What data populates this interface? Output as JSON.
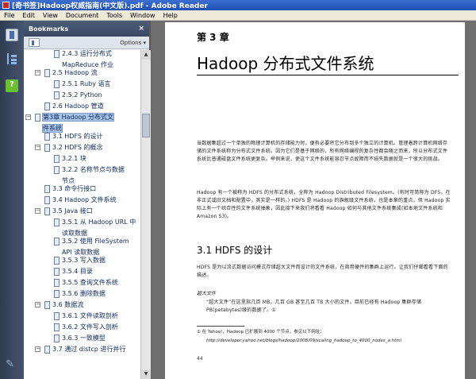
{
  "window": {
    "title": "[奇书签]Hadoop权威指南(中文版).pdf - Adobe Reader"
  },
  "menu": [
    "File",
    "Edit",
    "View",
    "Document",
    "Tools",
    "Window",
    "Help"
  ],
  "panel": {
    "title": "Bookmarks",
    "close": "×",
    "options": "Options ▾"
  },
  "bookmarks": [
    {
      "label": "2.4.3 运行分布式",
      "level": 2,
      "expand": ""
    },
    {
      "label": "MapReduce 作业",
      "level": 2,
      "cont": true
    },
    {
      "label": "2.5 Hadoop 流",
      "level": 1,
      "expand": "−"
    },
    {
      "label": "2.5.1 Ruby 语言",
      "level": 2
    },
    {
      "label": "2.5.2 Python",
      "level": 2
    },
    {
      "label": "2.6 Hadoop 管道",
      "level": 1
    },
    {
      "label": "第3章  Hadoop 分布式文",
      "level": 0,
      "expand": "−",
      "selected": true
    },
    {
      "label": "件系统",
      "level": 0,
      "cont": true,
      "selected": true
    },
    {
      "label": "3.1 HDFS 的设计",
      "level": 1
    },
    {
      "label": "3.2 HDFS 的概念",
      "level": 1,
      "expand": "−"
    },
    {
      "label": "3.2.1 块",
      "level": 2
    },
    {
      "label": "3.2.2 名称节点与数据",
      "level": 2
    },
    {
      "label": "节点",
      "level": 2,
      "cont": true
    },
    {
      "label": "3.3 命令行接口",
      "level": 1
    },
    {
      "label": "3.4 Hadoop 文件系统",
      "level": 1
    },
    {
      "label": "3.5 Java 接口",
      "level": 1,
      "expand": "−"
    },
    {
      "label": "3.5.1 从 Hadoop URL 中",
      "level": 2
    },
    {
      "label": "读取数据",
      "level": 2,
      "cont": true
    },
    {
      "label": "3.5.2 使用 FileSystem",
      "level": 2
    },
    {
      "label": "API 读取数据",
      "level": 2,
      "cont": true
    },
    {
      "label": "3.5.3 写入数据",
      "level": 2
    },
    {
      "label": "3.5.4 目录",
      "level": 2
    },
    {
      "label": "3.5.5 查询文件系统",
      "level": 2
    },
    {
      "label": "3.5.6 删除数据",
      "level": 2
    },
    {
      "label": "3.6 数据流",
      "level": 1,
      "expand": "−"
    },
    {
      "label": "3.6.1 文件读取剖析",
      "level": 2
    },
    {
      "label": "3.6.2 文件写入剖析",
      "level": 2
    },
    {
      "label": "3.6.3 一致模型",
      "level": 2
    },
    {
      "label": "3.7 通过 distcp 进行并行",
      "level": 1,
      "expand": "−"
    }
  ],
  "doc": {
    "chapter": "第 3 章",
    "title": "Hadoop 分布式文件系统",
    "intro": "当数据集超过一个单独的物理计算机的存储能力时，便有必要将它分布到多个独立的计算机。管理着跨计算机网络存储的文件系统称为分布式文件系统。因为它们是基于网络的，所有网络编程的复杂性都会随之而来，所以分布式文件系统比普通磁盘文件系统更复杂。举例来说，使这个文件系统能容忍节点故障而不损失数据就是一个很大的挑战。",
    "para2": "Hadoop 有一个被称为 HDFS 的分布式系统，全称为 Hadoop Distributed Filesystem。(有时可简称为 DFS，在非正式或旧文档和配置中，其实是一样的。) HDFS 是 Hadoop 的旗舰级文件系统，也是本章的重点，但 Hadoop 实际上有一个综合性的文件系统抽象，因此接下来我们将看看 Hadoop 如何与其他文件系统集成(如本地文件系统和 Amazon S3)。",
    "section": "3.1   HDFS 的设计",
    "para3": "HDFS 是为以流式数据访问模式存储超大文件而设计的文件系统，在商用硬件的集群上运行。让我们仔细看看下面的描述。",
    "sub": "超大文件",
    "para4": "“超大文件”在这里指几百 MB，几百 GB 甚至几百 TB 大小的文件。目前已经有 Hadoop 集群存储 PB(petabytes)级的数据了。①",
    "footnote1": "①  在 Yahoo!，Hadoop 已扩展到 4000 个节点，参见以下网址：",
    "footnote2": "http://developer.yahoo.net/blogs/hadoop/2008/09/scaling_hadoop_to_4000_nodes_a.html",
    "page_number": "44"
  }
}
